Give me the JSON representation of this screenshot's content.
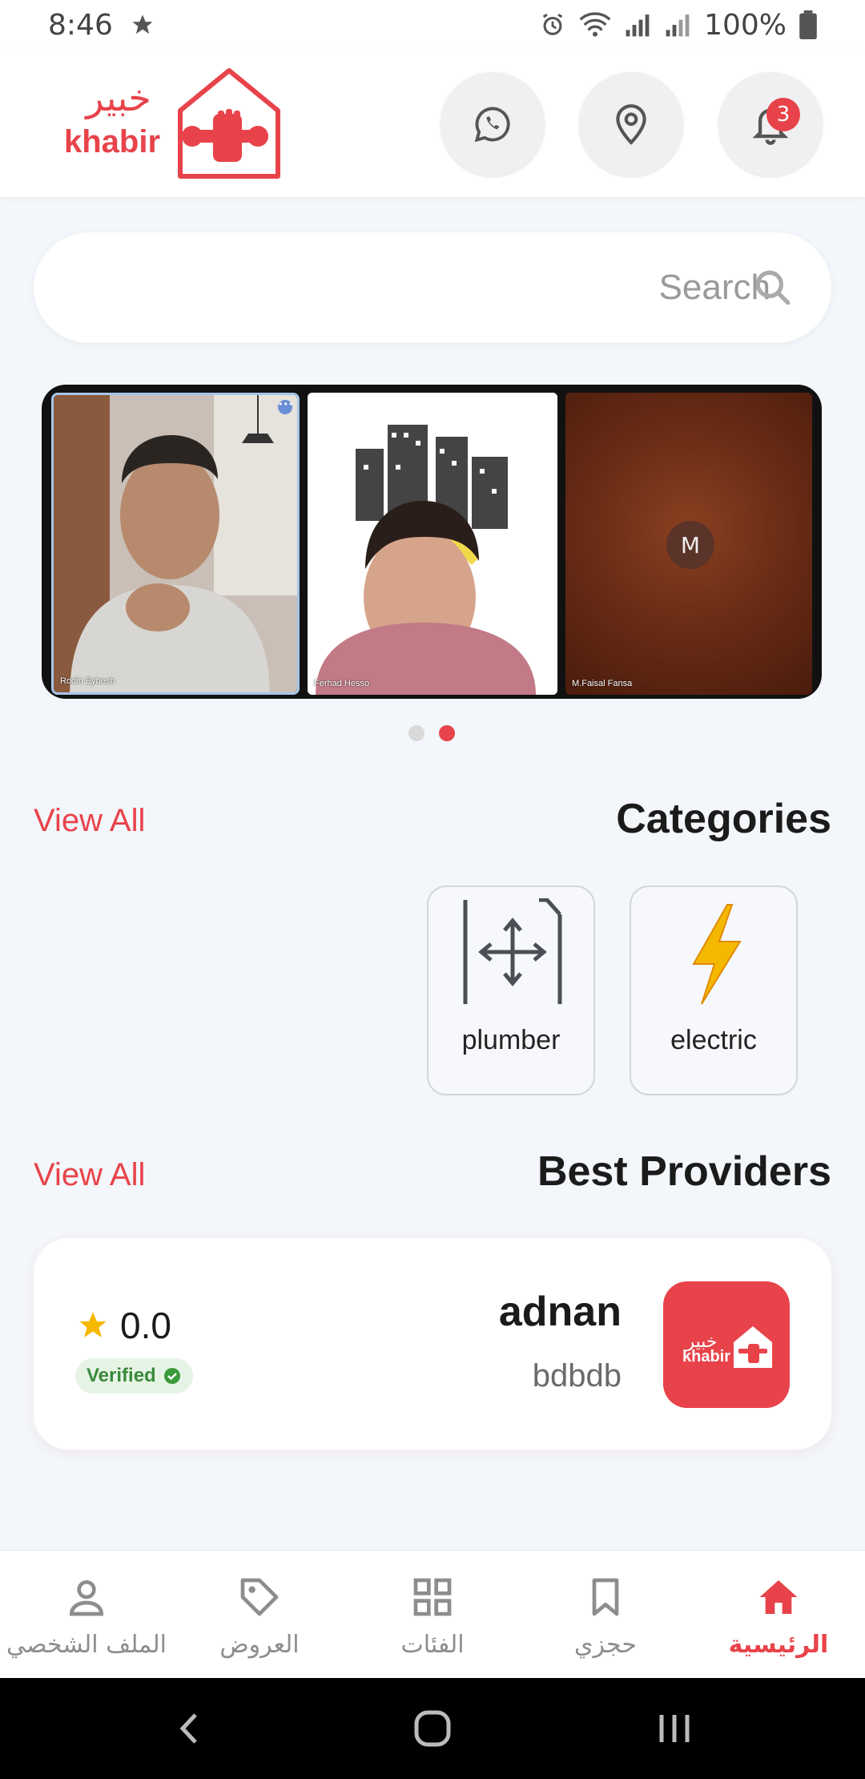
{
  "status_bar": {
    "time": "8:46",
    "battery": "100%"
  },
  "header": {
    "logo_arabic": "خبير",
    "logo_latin": "khabir",
    "notification_count": "3"
  },
  "search": {
    "placeholder": "Search",
    "value": ""
  },
  "banner": {
    "participants": [
      {
        "name": "Rodin Eybesh"
      },
      {
        "name": "Ferhad Hesso"
      },
      {
        "name": "M.Faisal Fansa",
        "initial": "M"
      }
    ],
    "active_page": 2,
    "page_count": 2
  },
  "categories": {
    "title": "Categories",
    "view_all": "View All",
    "items": [
      {
        "label": "plumber",
        "icon": "resize-arrows-icon"
      },
      {
        "label": "electric",
        "icon": "lightning-bolt-icon"
      }
    ]
  },
  "providers": {
    "title": "Best Providers",
    "view_all": "View All",
    "items": [
      {
        "name": "adnan",
        "subtitle": "bdbdb",
        "rating": "0.0",
        "badge": "Verified"
      }
    ]
  },
  "bottom_nav": {
    "items": [
      {
        "label": "الملف الشخصي",
        "icon": "user-icon"
      },
      {
        "label": "العروض",
        "icon": "tag-icon"
      },
      {
        "label": "الفئات",
        "icon": "grid-icon"
      },
      {
        "label": "حجزي",
        "icon": "bookmark-icon"
      },
      {
        "label": "الرئيسية",
        "icon": "home-icon",
        "active": true
      }
    ]
  },
  "colors": {
    "brand": "#e8434a",
    "background": "#f3f6fa",
    "verified_green": "#3a8a3a",
    "star": "#f5b800"
  }
}
